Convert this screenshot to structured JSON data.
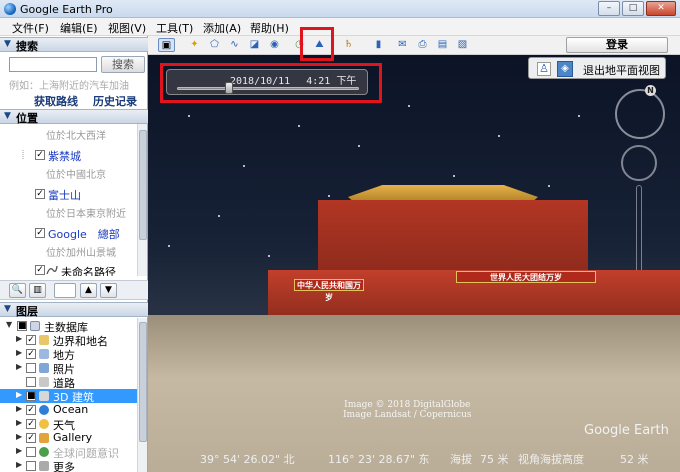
{
  "window": {
    "title": "Google Earth Pro",
    "minimize": "–",
    "maximize": "□",
    "close": "✕"
  },
  "menu": [
    "文件(F)",
    "编辑(E)",
    "视图(V)",
    "工具(T)",
    "添加(A)",
    "帮助(H)"
  ],
  "search": {
    "header": "搜索",
    "placeholder": "",
    "button": "搜索",
    "example": "例如：上海附近的汽车加油",
    "directions": "获取路线",
    "history": "历史记录"
  },
  "places": {
    "header": "位置",
    "items": [
      {
        "label": "位於北大西洋",
        "kind": "sub"
      },
      {
        "label": "紫禁城",
        "kind": "place",
        "checked": true
      },
      {
        "label": "位於中國北京",
        "kind": "sub"
      },
      {
        "label": "富士山",
        "kind": "place",
        "checked": true
      },
      {
        "label": "位於日本東京附近",
        "kind": "sub"
      },
      {
        "label": "Google　總部",
        "kind": "place",
        "checked": true
      },
      {
        "label": "位於加州山景城",
        "kind": "sub"
      },
      {
        "label": "未命名路径",
        "kind": "path",
        "checked": true
      }
    ]
  },
  "places_toolbar": {
    "search_icon": "search-icon",
    "panel_icon": "panel-icon",
    "up": "▲",
    "down": "▼"
  },
  "layers": {
    "header": "图层",
    "items": [
      {
        "label": "主数据库",
        "expand": "▼",
        "indent": 0
      },
      {
        "label": "边界和地名",
        "expand": "▶",
        "indent": 1
      },
      {
        "label": "地方",
        "expand": "▶",
        "indent": 1
      },
      {
        "label": "照片",
        "expand": "",
        "indent": 1
      },
      {
        "label": "道路",
        "expand": "",
        "indent": 1
      },
      {
        "label": "3D 建筑",
        "expand": "▶",
        "indent": 1,
        "selected": true
      },
      {
        "label": "Ocean",
        "expand": "▶",
        "indent": 1
      },
      {
        "label": "天气",
        "expand": "▶",
        "indent": 1
      },
      {
        "label": "Gallery",
        "expand": "▶",
        "indent": 1
      },
      {
        "label": "全球问题意识",
        "expand": "▶",
        "indent": 1
      },
      {
        "label": "更多",
        "expand": "▶",
        "indent": 1
      }
    ]
  },
  "toolbar": {
    "signin": "登录"
  },
  "view": {
    "time_text": "2018/10/11　 4:21 下午",
    "time_position": 0.3,
    "exit_ground": "退出地平面视图",
    "compass_n": "N",
    "copyright_line1": "Image © 2018 DigitalGlobe",
    "copyright_line2": "Image Landsat / Copernicus",
    "logo": "Google Earth",
    "status": {
      "lat": "39° 54' 26.02\" 北",
      "lng": "116° 23' 28.67\" 东",
      "elev_label": "海拔",
      "elev": "75 米",
      "eye_label": "视角海拔高度",
      "eye": "52 米"
    },
    "signs": {
      "gate": "中华人民共和国万岁",
      "wall": "世界人民大团结万岁"
    }
  },
  "colors": {
    "highlight": "#e0141c",
    "selected_row": "#3399ff"
  }
}
